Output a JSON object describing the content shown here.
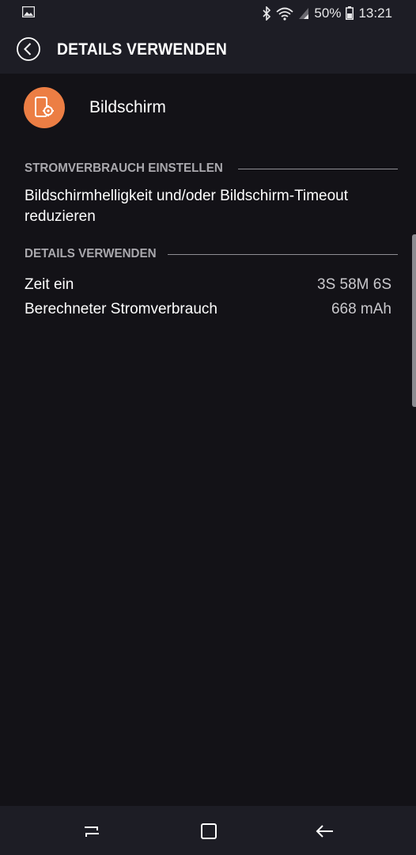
{
  "status_bar": {
    "battery_percent": "50%",
    "time": "13:21",
    "icons": [
      "image-icon",
      "bluetooth-icon",
      "wifi-icon",
      "signal-icon",
      "battery-icon"
    ]
  },
  "app_bar": {
    "title": "DETAILS VERWENDEN",
    "back_icon": "back-circle-icon"
  },
  "item": {
    "name": "Bildschirm",
    "icon": "screen-settings-icon",
    "icon_color": "#ec7e44"
  },
  "section_power": {
    "header": "STROMVERBRAUCH EINSTELLEN",
    "description": "Bildschirmhelligkeit und/oder Bildschirm-Timeout reduzieren"
  },
  "section_details": {
    "header": "DETAILS VERWENDEN",
    "rows": [
      {
        "label": "Zeit ein",
        "value": "3S 58M 6S"
      },
      {
        "label": "Berechneter Stromverbrauch",
        "value": "668 mAh"
      }
    ]
  },
  "nav_bar": {
    "buttons": [
      "recents-icon",
      "home-icon",
      "back-arrow-icon"
    ]
  }
}
